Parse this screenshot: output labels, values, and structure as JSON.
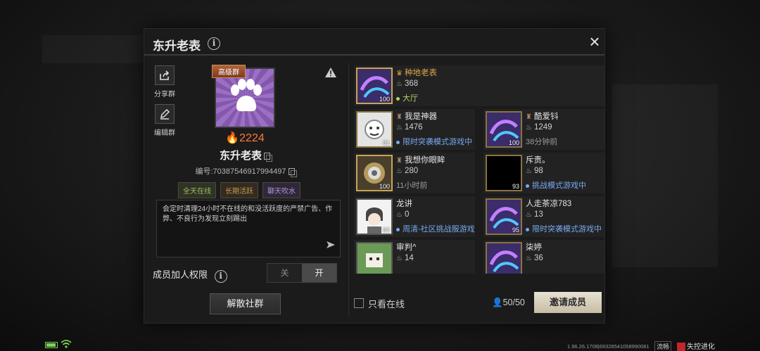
{
  "dialog": {
    "title": "东升老表",
    "close_label": "×"
  },
  "left": {
    "share_label": "分享群",
    "edit_label": "编辑群",
    "grade_badge": "高级群",
    "heat": "2224",
    "group_name": "东升老表",
    "group_id": "编号:70387546917994497",
    "tags": [
      "全天在线",
      "长期活跃",
      "聊天吹水"
    ],
    "notice": "会定时清理24小时不在线的和没活跃度的严禁广告、作弊、不良行为发现立刻踢出",
    "permission_label": "成员加人权限",
    "toggle_off": "关",
    "toggle_on": "开",
    "toggle_state": "开",
    "disband_label": "解散社群"
  },
  "members": [
    {
      "name": "种地老表",
      "role": "leader",
      "heat": "368",
      "level": "100",
      "status": "大厅",
      "status_type": "online"
    },
    {
      "name": "我是神器",
      "role": "member",
      "heat": "1476",
      "level": "61",
      "status": "限时突袭模式游戏中",
      "status_type": "game"
    },
    {
      "name": "酷爱钭",
      "role": "member",
      "heat": "1249",
      "level": "100",
      "status": "38分钟前",
      "status_type": "offline"
    },
    {
      "name": "我想你眼眸",
      "role": "member",
      "heat": "280",
      "level": "100",
      "status": "11小时前",
      "status_type": "offline"
    },
    {
      "name": "斥责。",
      "role": "member",
      "heat": "98",
      "level": "93",
      "status": "挑战模式游戏中",
      "status_type": "game"
    },
    {
      "name": "龙讲",
      "role": "member",
      "heat": "0",
      "level": "80",
      "status": "周清-社区挑战服游戏",
      "status_type": "game"
    },
    {
      "name": "人走茶凉783",
      "role": "member",
      "heat": "13",
      "level": "95",
      "status": "限时突袭模式游戏中",
      "status_type": "game"
    },
    {
      "name": "审判^",
      "role": "member",
      "heat": "14",
      "level": "",
      "status": "",
      "status_type": "offline"
    },
    {
      "name": "柒婷",
      "role": "member",
      "heat": "36",
      "level": "",
      "status": "",
      "status_type": "offline"
    }
  ],
  "footer": {
    "only_online_label": "只看在线",
    "member_count": "50/50",
    "invite_label": "邀请成员"
  },
  "statusbar": {
    "version": "1.96.26.1708|69328541058990081",
    "fluency": "流畅",
    "brand": "失控进化"
  },
  "colors": {
    "accent": "#e0a44a",
    "heat": "#ff7a3a",
    "online": "#b7d36a",
    "in_game": "#78a8f0"
  }
}
